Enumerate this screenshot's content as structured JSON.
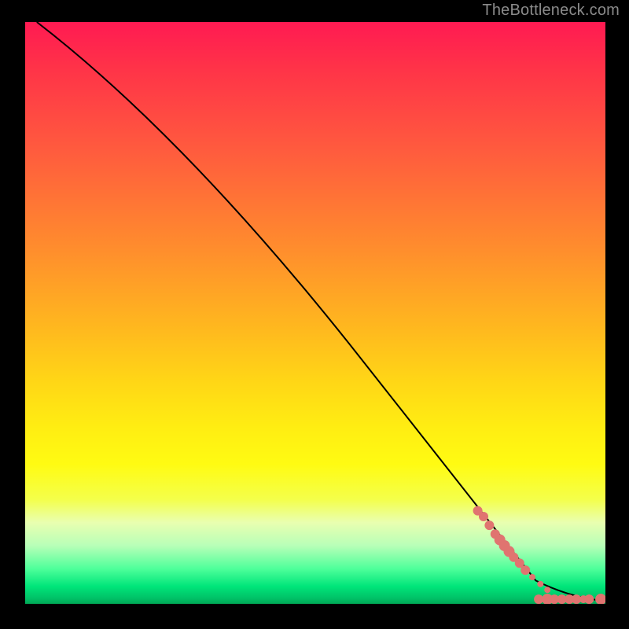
{
  "attribution": "TheBottleneck.com",
  "colors": {
    "frame": "#000000",
    "curve": "#000000",
    "dot": "#e07470",
    "gradient_top": "#ff1a52",
    "gradient_bottom": "#00a856"
  },
  "chart_data": {
    "type": "line",
    "title": "",
    "xlabel": "",
    "ylabel": "",
    "xlim": [
      0,
      100
    ],
    "ylim": [
      0,
      100
    ],
    "series": [
      {
        "name": "bottleneck-curve",
        "kind": "line",
        "points": [
          {
            "x": 2,
            "y": 100
          },
          {
            "x": 28,
            "y": 80
          },
          {
            "x": 88,
            "y": 4
          },
          {
            "x": 94,
            "y": 1
          },
          {
            "x": 100,
            "y": 0.5
          }
        ]
      },
      {
        "name": "sample-dots",
        "kind": "scatter",
        "points": [
          {
            "x": 78,
            "y": 16,
            "r": 6
          },
          {
            "x": 79,
            "y": 15,
            "r": 6
          },
          {
            "x": 80,
            "y": 13.5,
            "r": 6
          },
          {
            "x": 81,
            "y": 12,
            "r": 6
          },
          {
            "x": 81.8,
            "y": 11,
            "r": 7
          },
          {
            "x": 82.6,
            "y": 10,
            "r": 7
          },
          {
            "x": 83.4,
            "y": 9,
            "r": 7
          },
          {
            "x": 84.2,
            "y": 8,
            "r": 6
          },
          {
            "x": 85.2,
            "y": 7,
            "r": 6
          },
          {
            "x": 86.2,
            "y": 5.8,
            "r": 6
          },
          {
            "x": 87.4,
            "y": 4.6,
            "r": 4
          },
          {
            "x": 88.8,
            "y": 3.4,
            "r": 4
          },
          {
            "x": 90.0,
            "y": 2.4,
            "r": 4
          },
          {
            "x": 88.5,
            "y": 0.8,
            "r": 6
          },
          {
            "x": 90.0,
            "y": 0.8,
            "r": 7
          },
          {
            "x": 91.2,
            "y": 0.8,
            "r": 6
          },
          {
            "x": 92.5,
            "y": 0.8,
            "r": 6
          },
          {
            "x": 93.8,
            "y": 0.8,
            "r": 6
          },
          {
            "x": 95.0,
            "y": 0.8,
            "r": 6
          },
          {
            "x": 96.2,
            "y": 0.8,
            "r": 5
          },
          {
            "x": 97.2,
            "y": 0.8,
            "r": 6
          },
          {
            "x": 99.2,
            "y": 0.8,
            "r": 7
          },
          {
            "x": 100.6,
            "y": 0.8,
            "r": 6
          }
        ]
      }
    ]
  }
}
